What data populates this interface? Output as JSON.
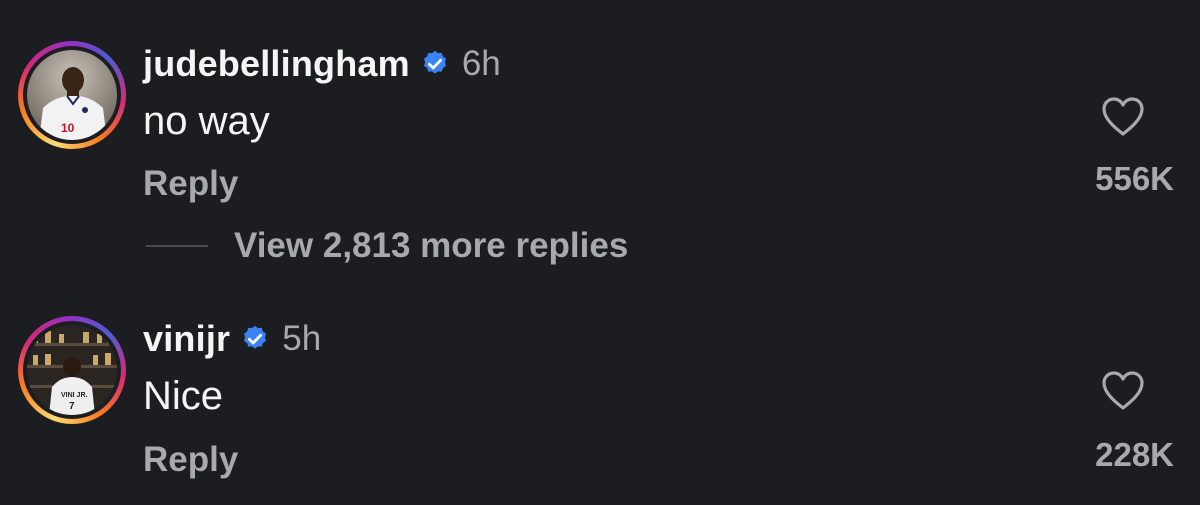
{
  "comments": [
    {
      "username": "judebellingham",
      "time": "6h",
      "text": "no way",
      "reply_label": "Reply",
      "likes": "556K",
      "avatar_icon": "avatar-england-player",
      "verified_icon": "verified-badge-icon"
    },
    {
      "username": "vinijr",
      "time": "5h",
      "text": "Nice",
      "reply_label": "Reply",
      "likes": "228K",
      "avatar_icon": "avatar-trophy-room",
      "verified_icon": "verified-badge-icon"
    }
  ],
  "view_more_replies": "View 2,813 more replies",
  "colors": {
    "background": "#1c1d21",
    "primary_text": "#f5f5f5",
    "secondary_text": "#a8a8ad",
    "verified_blue": "#3b82f6"
  }
}
